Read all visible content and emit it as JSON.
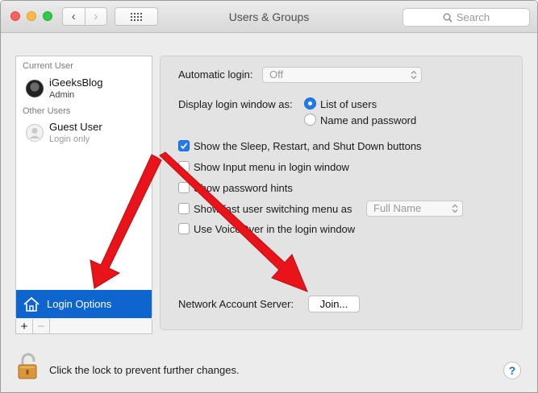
{
  "window": {
    "title": "Users & Groups",
    "search_placeholder": "Search"
  },
  "sidebar": {
    "current_user_header": "Current User",
    "current_user": {
      "name": "iGeeksBlog",
      "role": "Admin"
    },
    "other_users_header": "Other Users",
    "other_users": [
      {
        "name": "Guest User",
        "role": "Login only"
      }
    ],
    "selected_item": "Login Options",
    "add_label": "+",
    "remove_label": "−"
  },
  "login_options": {
    "automatic_login_label": "Automatic login:",
    "automatic_login_value": "Off",
    "display_label": "Display login window as:",
    "display_options": [
      {
        "label": "List of users",
        "selected": true
      },
      {
        "label": "Name and password",
        "selected": false
      }
    ],
    "checkboxes": [
      {
        "label": "Show the Sleep, Restart, and Shut Down buttons",
        "checked": true
      },
      {
        "label": "Show Input menu in login window",
        "checked": false
      },
      {
        "label": "Show password hints",
        "checked": false
      },
      {
        "label": "Show fast user switching menu as",
        "checked": false
      },
      {
        "label": "Use VoiceOver in the login window",
        "checked": false
      }
    ],
    "fast_switch_value": "Full Name",
    "network_server_label": "Network Account Server:",
    "join_label": "Join..."
  },
  "footer": {
    "lock_text": "Click the lock to prevent further changes.",
    "help_label": "?"
  },
  "colors": {
    "selection": "#0e65d0",
    "accent": "#1e7cf2",
    "annotation_arrow": "#e8141a"
  }
}
